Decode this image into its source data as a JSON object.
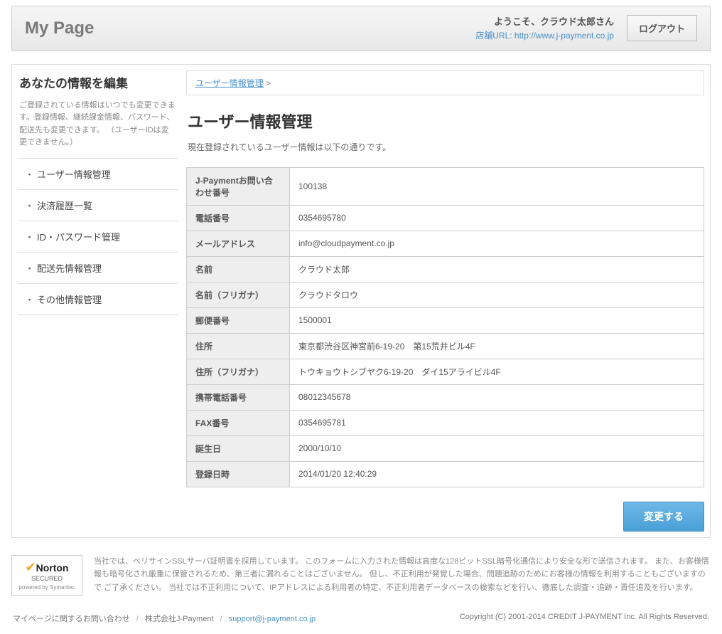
{
  "header": {
    "logo": "My Page",
    "welcome": "ようこそ、クラウド太郎さん",
    "shop_url_label": "店舗URL: ",
    "shop_url": "http://www.j-payment.co.jp",
    "logout": "ログアウト"
  },
  "sidebar": {
    "title": "あなたの情報を編集",
    "desc": "ご登録されている情報はいつでも変更できます。登録情報、継続課金情報、パスワード、配送先も変更できます。\n（ユーザーIDは変更できません。）",
    "items": [
      "ユーザー情報管理",
      "決済履歴一覧",
      "ID・パスワード管理",
      "配送先情報管理",
      "その他情報管理"
    ]
  },
  "breadcrumb": {
    "link": "ユーザー情報管理",
    "sep": " >"
  },
  "main": {
    "title": "ユーザー情報管理",
    "subtitle": "現在登録されているユーザー情報は以下の通りです。",
    "rows": [
      {
        "label": "J-Paymentお問い合わせ番号",
        "value": "100138"
      },
      {
        "label": "電話番号",
        "value": "0354695780"
      },
      {
        "label": "メールアドレス",
        "value": "info@cloudpayment.co.jp"
      },
      {
        "label": "名前",
        "value": "クラウド太郎"
      },
      {
        "label": "名前（フリガナ）",
        "value": "クラウドタロウ"
      },
      {
        "label": "郵便番号",
        "value": "1500001"
      },
      {
        "label": "住所",
        "value": "東京都渋谷区神宮前6-19-20　第15荒井ビル4F"
      },
      {
        "label": "住所（フリガナ）",
        "value": "トウキョウトシブヤク6-19-20　ダイ15アライビル4F"
      },
      {
        "label": "携帯電話番号",
        "value": "08012345678"
      },
      {
        "label": "FAX番号",
        "value": "0354695781"
      },
      {
        "label": "誕生日",
        "value": "2000/10/10"
      },
      {
        "label": "登録日時",
        "value": "2014/01/20 12:40:29"
      }
    ],
    "change_btn": "変更する"
  },
  "security": {
    "badge_brand": "Norton",
    "badge_secured": "SECURED",
    "badge_powered": "powered by Symantec",
    "text": "当社では、ベリサインSSLサーバ証明書を採用しています。 このフォームに入力された情報は高度な128ビットSSL暗号化通信により安全な形で送信されます。 また、お客様情報も暗号化され厳重に保管されるため、第三者に漏れることはございません。 但し、不正利用が発覚した場合、問題追跡のためにお客様の情報を利用することもございますので ご了承ください。 当社では不正利用について、IPアドレスによる利用者の特定、不正利用者データベースの検索などを行い、徹底した調査・追跡・責任追及を行います。"
  },
  "footer": {
    "contact_label": "マイページに関するお問い合わせ",
    "company": "株式会社J-Payment",
    "email": "support@j-payment.co.jp",
    "copyright": "Copyright (C) 2001-2014 CREDIT J-PAYMENT Inc. All Rights Reserved."
  }
}
